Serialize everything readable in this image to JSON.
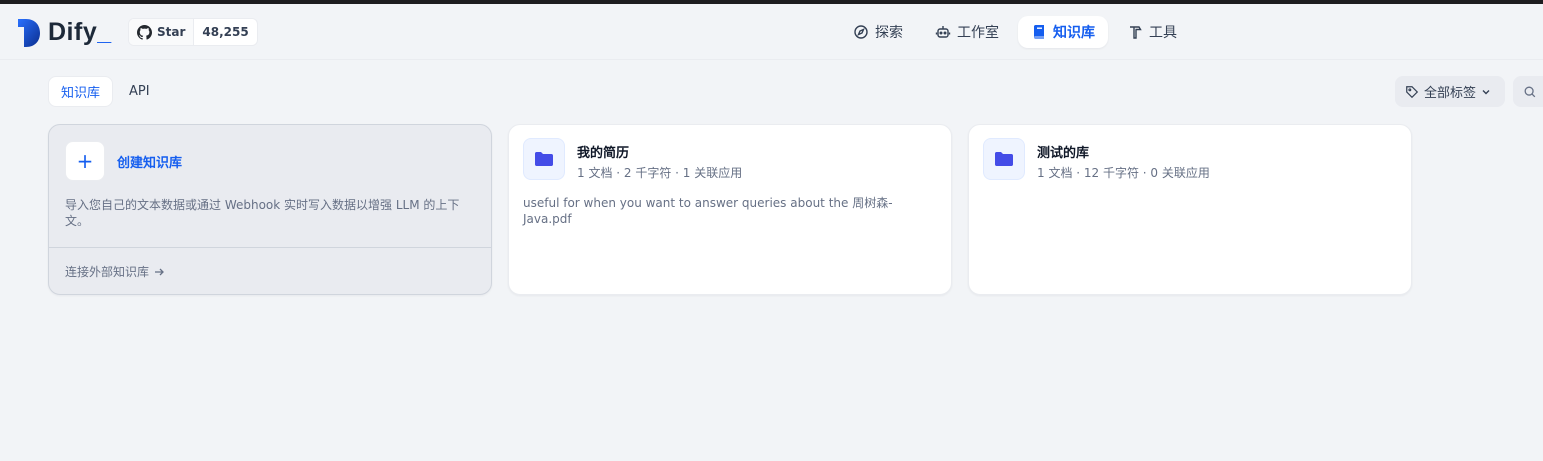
{
  "brand": {
    "name": "Dify",
    "cursor": "_"
  },
  "github": {
    "star_label": "Star",
    "count": "48,255"
  },
  "nav": {
    "explore": "探索",
    "studio": "工作室",
    "knowledge": "知识库",
    "tools": "工具"
  },
  "tabs": {
    "knowledge": "知识库",
    "api": "API"
  },
  "filter": {
    "tags_label": "全部标签"
  },
  "create_card": {
    "title": "创建知识库",
    "description": "导入您自己的文本数据或通过 Webhook 实时写入数据以增强 LLM 的上下文。",
    "external_link": "连接外部知识库"
  },
  "datasets": [
    {
      "name": "我的简历",
      "meta": "1 文档 · 2 千字符 · 1 关联应用",
      "description": "useful for when you want to answer queries about the 周树森-Java.pdf"
    },
    {
      "name": "测试的库",
      "meta": "1 文档 · 12 千字符 · 0 关联应用",
      "description": ""
    }
  ],
  "colors": {
    "accent": "#155eef",
    "folder": "#444ce7",
    "background": "#f2f4f7"
  }
}
